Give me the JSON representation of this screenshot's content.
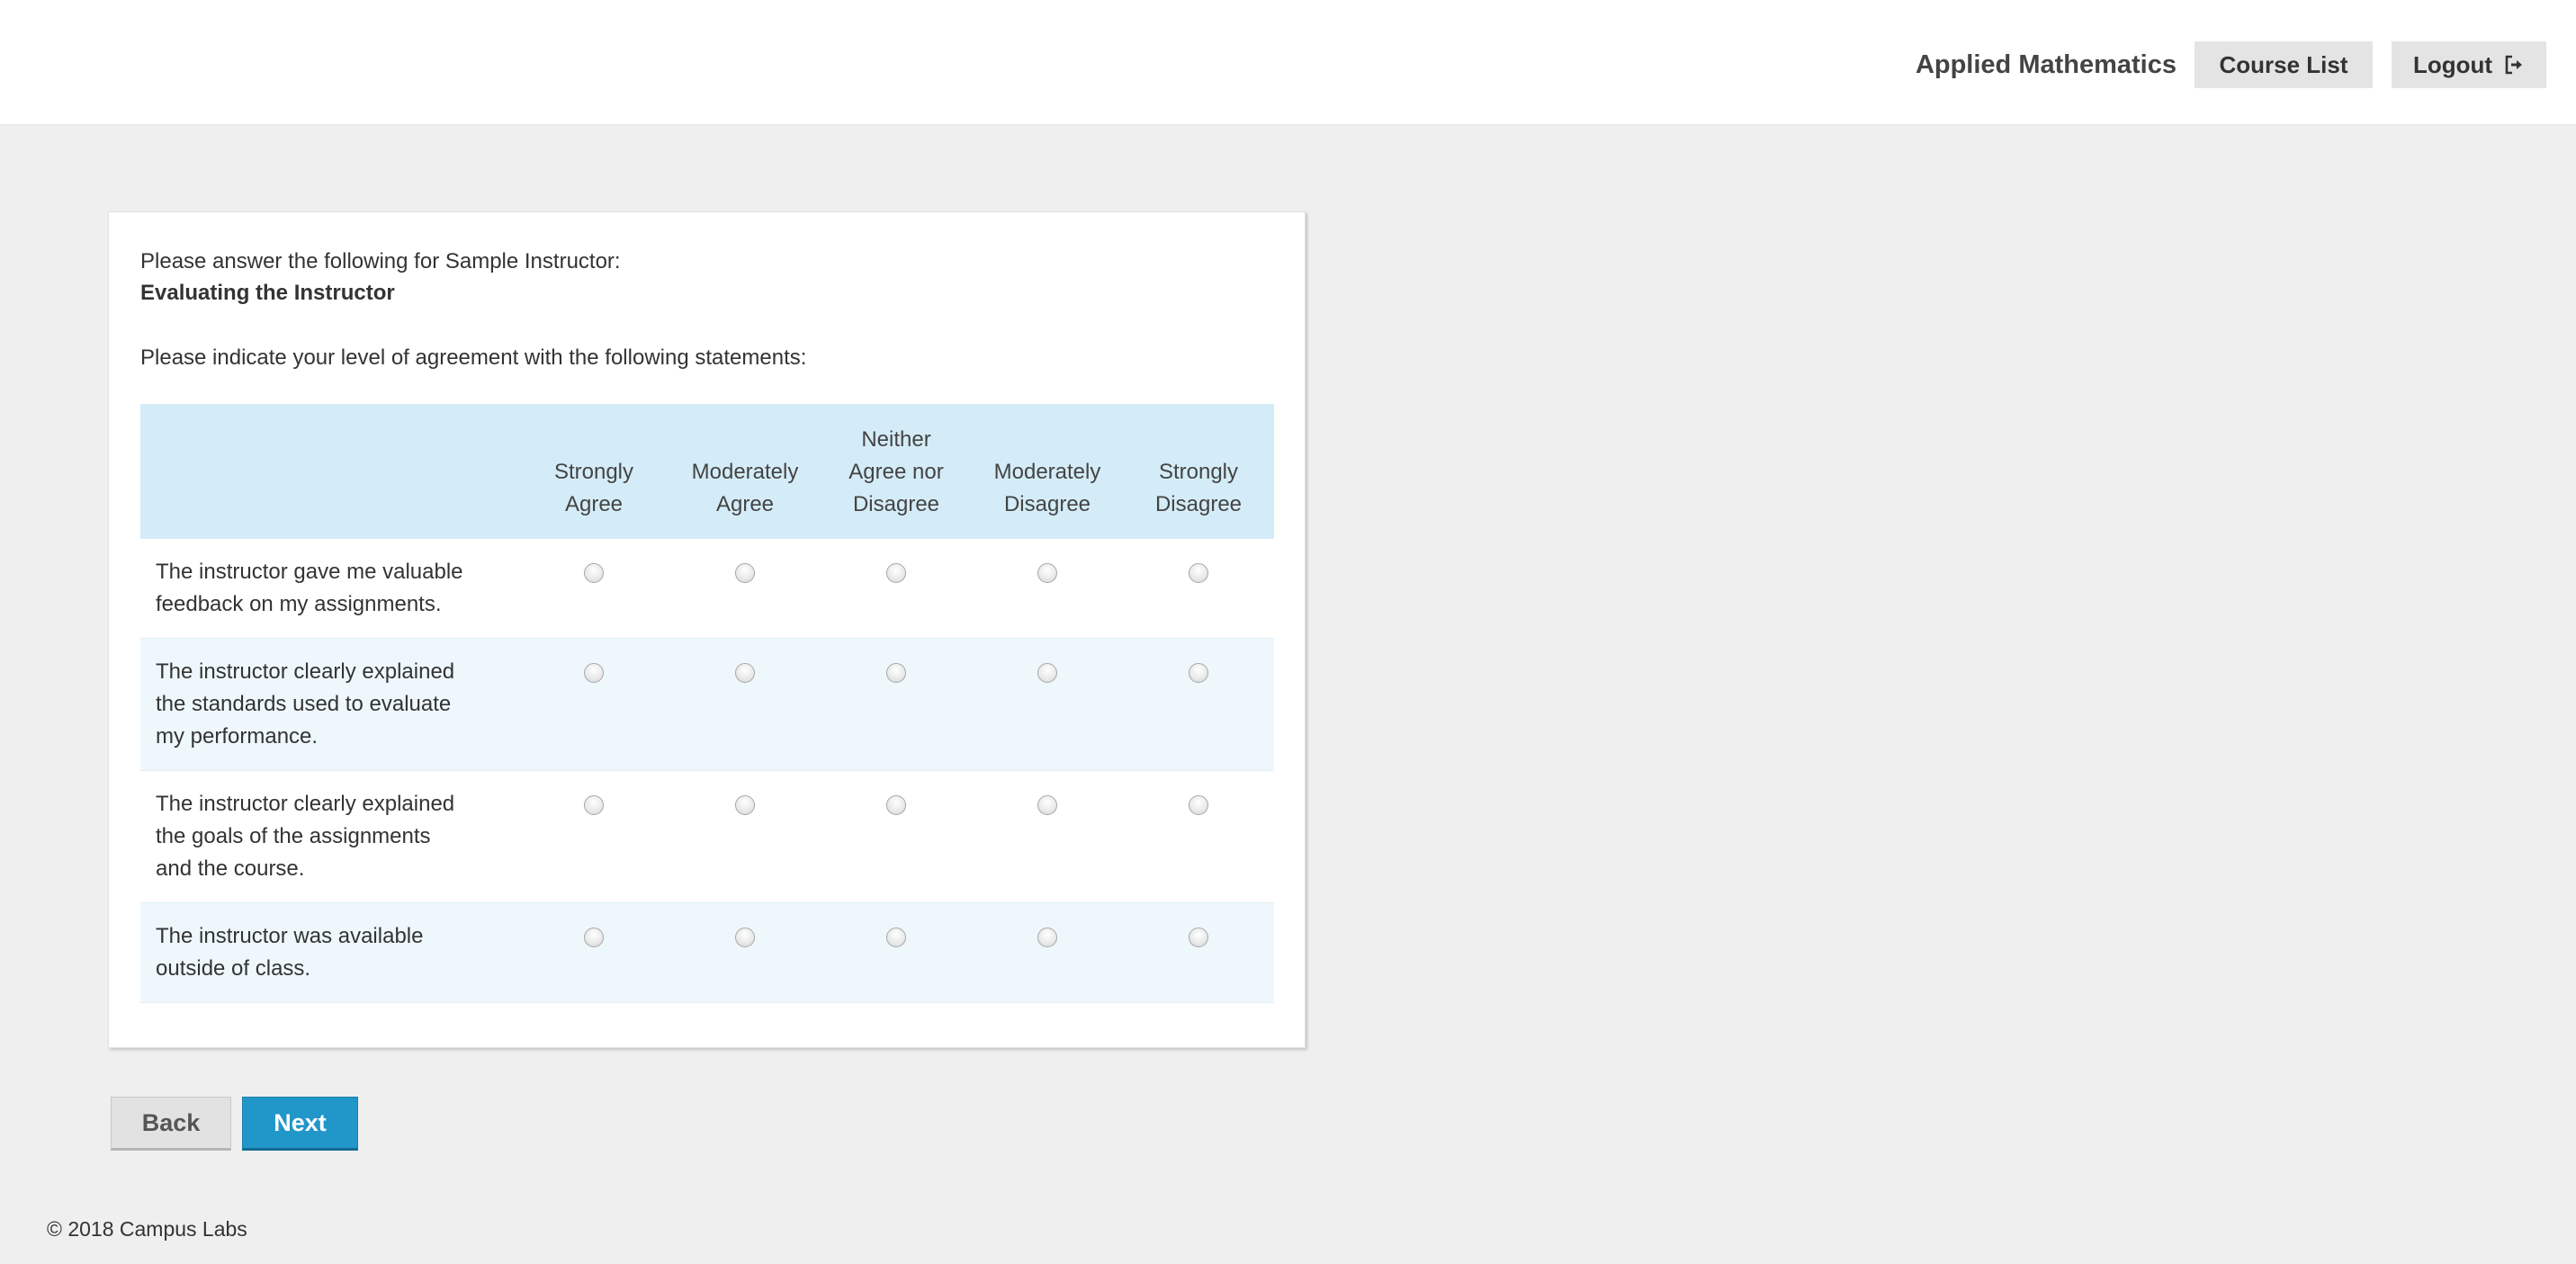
{
  "header": {
    "course_title": "Applied Mathematics",
    "course_list_label": "Course List",
    "logout_label": "Logout"
  },
  "survey": {
    "intro": "Please answer the following for Sample Instructor:",
    "section_title": "Evaluating the Instructor",
    "instructions": "Please indicate your level of agreement with the following statements:",
    "columns": [
      [
        "Strongly",
        "Agree"
      ],
      [
        "Moderately",
        "Agree"
      ],
      [
        "Neither",
        "Agree nor",
        "Disagree"
      ],
      [
        "Moderately",
        "Disagree"
      ],
      [
        "Strongly",
        "Disagree"
      ]
    ],
    "statements": [
      [
        "The instructor gave me valuable",
        "feedback on my assignments."
      ],
      [
        "The instructor clearly explained",
        "the standards used to evaluate",
        "my performance."
      ],
      [
        "The instructor clearly explained",
        "the goals of the assignments",
        "and the course."
      ],
      [
        "The instructor was available",
        "outside of class."
      ]
    ]
  },
  "nav": {
    "back_label": "Back",
    "next_label": "Next"
  },
  "footer": {
    "copyright": "© 2018 Campus Labs"
  },
  "colors": {
    "header_row": "#d4ecf7",
    "alt_row": "#eef8fc",
    "next_button": "#2196c9"
  }
}
